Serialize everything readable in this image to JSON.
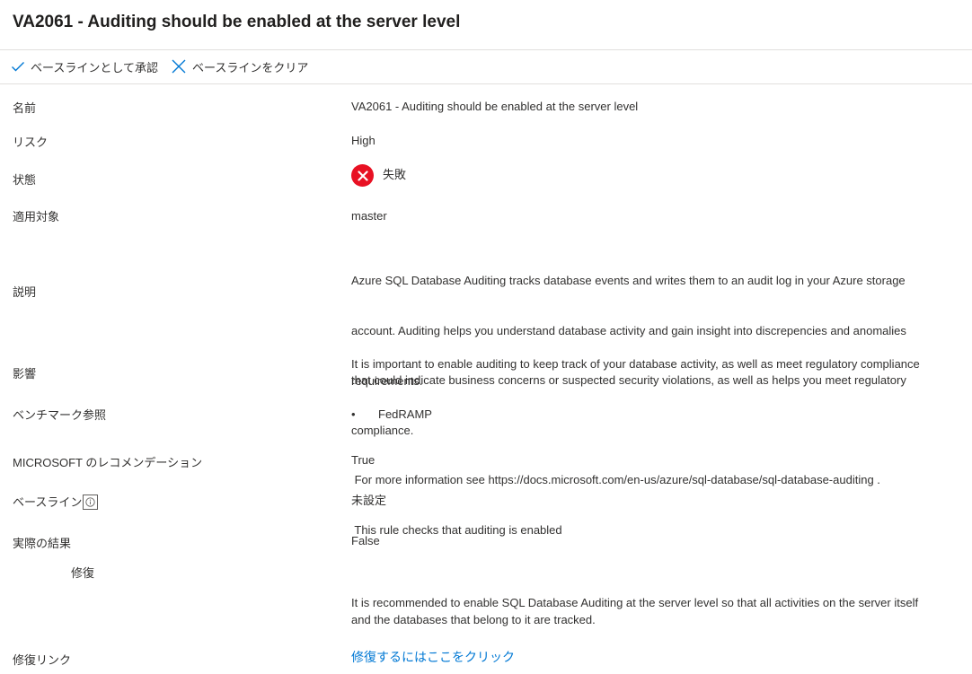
{
  "title": "VA2061 - Auditing should be enabled at the server level",
  "toolbar": {
    "approve_label": "ベースラインとして承認",
    "clear_label": "ベースラインをクリア"
  },
  "fields": {
    "name": {
      "label": "名前",
      "value": "VA2061 - Auditing should be enabled at the server level"
    },
    "risk": {
      "label": "リスク",
      "value": "High"
    },
    "status": {
      "label": "状態",
      "value": "失敗",
      "icon": "error-circle-icon",
      "color": "#e81123"
    },
    "applies_to": {
      "label": "適用対象",
      "value": "master"
    },
    "description": {
      "label": "説明",
      "lines": [
        "Azure SQL Database Auditing tracks database events and writes them to an audit log in your Azure storage",
        "account. Auditing helps you understand database activity and gain insight into discrepencies and anomalies",
        "that could indicate business concerns or suspected security violations, as well as helps you meet regulatory",
        "compliance.",
        " For more information see https://docs.microsoft.com/en-us/azure/sql-database/sql-database-auditing .",
        " This rule checks that auditing is enabled"
      ]
    },
    "impact": {
      "label": "影響",
      "lines": [
        "It is important to enable auditing to keep track of your database activity, as well as meet regulatory compliance",
        "requirements."
      ]
    },
    "benchmark": {
      "label": "ベンチマーク参照",
      "bullet": "•",
      "items": [
        "FedRAMP"
      ]
    },
    "ms_recommendation": {
      "label": "MICROSOFT のレコメンデーション",
      "value": "True"
    },
    "baseline": {
      "label": "ベースライン",
      "value": "未設定",
      "info_icon": "info-icon"
    },
    "actual_result": {
      "label": "実際の結果",
      "value": "False"
    },
    "remediation": {
      "label": "修復",
      "lines": [
        "It is recommended to enable SQL Database Auditing at the server level so that all activities on the server itself",
        "and the databases that belong to it are tracked."
      ]
    },
    "remediation_link": {
      "label": "修復リンク",
      "value": "修復するにはここをクリック"
    }
  }
}
